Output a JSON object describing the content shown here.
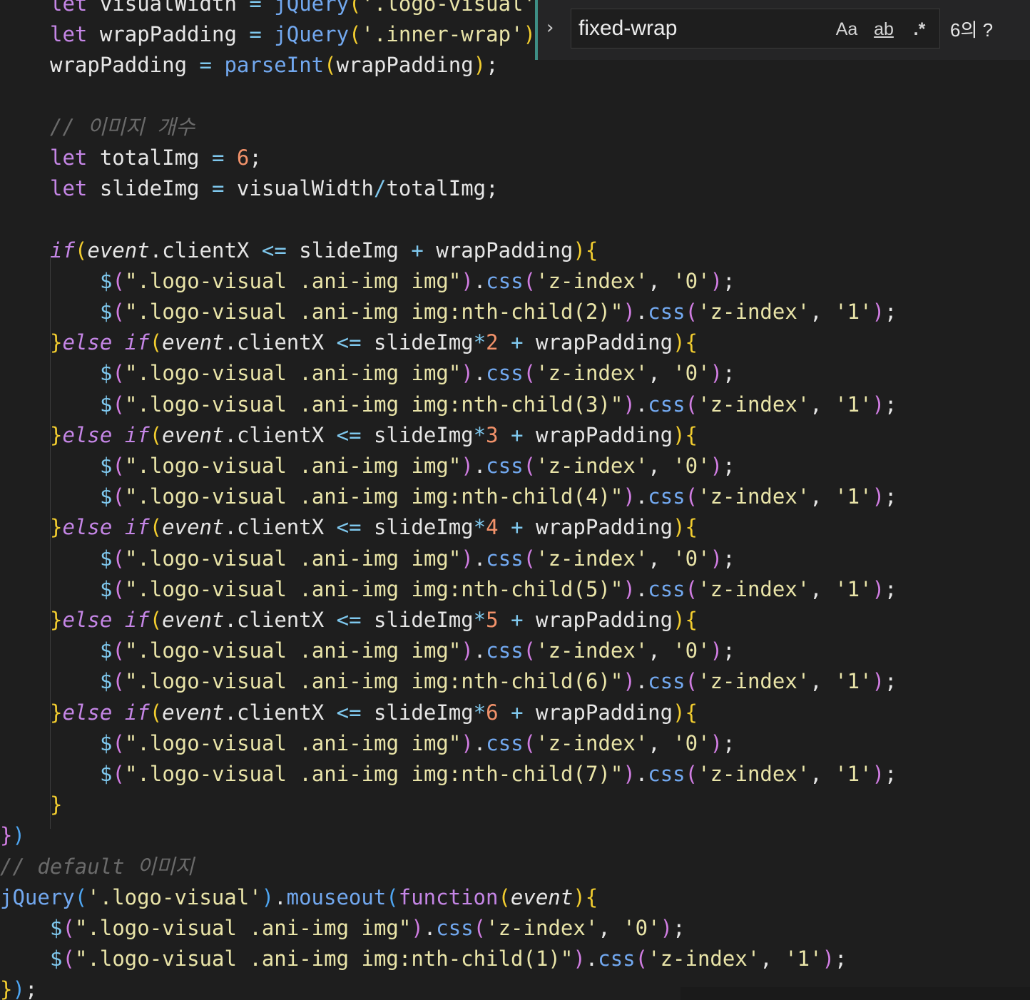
{
  "find_widget": {
    "query": "fixed-wrap",
    "match_case_label": "Aa",
    "whole_word_label": "ab",
    "regex_label": ".*",
    "result_count": "6의 ?",
    "expand_icon": "chevron-right-icon"
  },
  "code": [
    {
      "indent": 1,
      "tokens": [
        [
          "k",
          "let "
        ],
        [
          "v",
          "visualWidth "
        ],
        [
          "o",
          "= "
        ],
        [
          "f",
          "jQuery"
        ],
        [
          "b1",
          "("
        ],
        [
          "s",
          "'.logo-visual'"
        ]
      ]
    },
    {
      "indent": 1,
      "tokens": [
        [
          "k",
          "let "
        ],
        [
          "v",
          "wrapPadding "
        ],
        [
          "o",
          "= "
        ],
        [
          "f",
          "jQuery"
        ],
        [
          "b1",
          "("
        ],
        [
          "s",
          "'.inner-wrap'"
        ],
        [
          "b1",
          ")"
        ]
      ]
    },
    {
      "indent": 1,
      "tokens": [
        [
          "v",
          "wrapPadding "
        ],
        [
          "o",
          "= "
        ],
        [
          "f",
          "parseInt"
        ],
        [
          "b1",
          "("
        ],
        [
          "v",
          "wrapPadding"
        ],
        [
          "b1",
          ")"
        ],
        [
          "p",
          ";"
        ]
      ]
    },
    {
      "indent": 0,
      "tokens": []
    },
    {
      "indent": 1,
      "tokens": [
        [
          "c",
          "// 이미지 개수"
        ]
      ]
    },
    {
      "indent": 1,
      "tokens": [
        [
          "k",
          "let "
        ],
        [
          "v",
          "totalImg "
        ],
        [
          "o",
          "= "
        ],
        [
          "n",
          "6"
        ],
        [
          "p",
          ";"
        ]
      ]
    },
    {
      "indent": 1,
      "tokens": [
        [
          "k",
          "let "
        ],
        [
          "v",
          "slideImg "
        ],
        [
          "o",
          "= "
        ],
        [
          "v",
          "visualWidth"
        ],
        [
          "o",
          "/"
        ],
        [
          "v",
          "totalImg"
        ],
        [
          "p",
          ";"
        ]
      ]
    },
    {
      "indent": 0,
      "tokens": []
    },
    {
      "indent": 1,
      "tokens": [
        [
          "ki",
          "if"
        ],
        [
          "b1",
          "("
        ],
        [
          "it",
          "event"
        ],
        [
          "p",
          "."
        ],
        [
          "v",
          "clientX "
        ],
        [
          "o",
          "<= "
        ],
        [
          "v",
          "slideImg "
        ],
        [
          "o",
          "+ "
        ],
        [
          "v",
          "wrapPadding"
        ],
        [
          "b1",
          ")"
        ],
        [
          "b1",
          "{"
        ]
      ]
    },
    {
      "indent": 2,
      "tokens": [
        [
          "o",
          "$"
        ],
        [
          "b2",
          "("
        ],
        [
          "s",
          "\".logo-visual .ani-img img\""
        ],
        [
          "b2",
          ")"
        ],
        [
          "p",
          "."
        ],
        [
          "f",
          "css"
        ],
        [
          "b2",
          "("
        ],
        [
          "s",
          "'z-index'"
        ],
        [
          "p",
          ", "
        ],
        [
          "s",
          "'0'"
        ],
        [
          "b2",
          ")"
        ],
        [
          "p",
          ";"
        ]
      ]
    },
    {
      "indent": 2,
      "tokens": [
        [
          "o",
          "$"
        ],
        [
          "b2",
          "("
        ],
        [
          "s",
          "\".logo-visual .ani-img img:nth-child(2)\""
        ],
        [
          "b2",
          ")"
        ],
        [
          "p",
          "."
        ],
        [
          "f",
          "css"
        ],
        [
          "b2",
          "("
        ],
        [
          "s",
          "'z-index'"
        ],
        [
          "p",
          ", "
        ],
        [
          "s",
          "'1'"
        ],
        [
          "b2",
          ")"
        ],
        [
          "p",
          ";"
        ]
      ]
    },
    {
      "indent": 1,
      "tokens": [
        [
          "b1",
          "}"
        ],
        [
          "ki",
          "else if"
        ],
        [
          "b1",
          "("
        ],
        [
          "it",
          "event"
        ],
        [
          "p",
          "."
        ],
        [
          "v",
          "clientX "
        ],
        [
          "o",
          "<= "
        ],
        [
          "v",
          "slideImg"
        ],
        [
          "o",
          "*"
        ],
        [
          "n",
          "2 "
        ],
        [
          "o",
          "+ "
        ],
        [
          "v",
          "wrapPadding"
        ],
        [
          "b1",
          ")"
        ],
        [
          "b1",
          "{"
        ]
      ]
    },
    {
      "indent": 2,
      "tokens": [
        [
          "o",
          "$"
        ],
        [
          "b2",
          "("
        ],
        [
          "s",
          "\".logo-visual .ani-img img\""
        ],
        [
          "b2",
          ")"
        ],
        [
          "p",
          "."
        ],
        [
          "f",
          "css"
        ],
        [
          "b2",
          "("
        ],
        [
          "s",
          "'z-index'"
        ],
        [
          "p",
          ", "
        ],
        [
          "s",
          "'0'"
        ],
        [
          "b2",
          ")"
        ],
        [
          "p",
          ";"
        ]
      ]
    },
    {
      "indent": 2,
      "tokens": [
        [
          "o",
          "$"
        ],
        [
          "b2",
          "("
        ],
        [
          "s",
          "\".logo-visual .ani-img img:nth-child(3)\""
        ],
        [
          "b2",
          ")"
        ],
        [
          "p",
          "."
        ],
        [
          "f",
          "css"
        ],
        [
          "b2",
          "("
        ],
        [
          "s",
          "'z-index'"
        ],
        [
          "p",
          ", "
        ],
        [
          "s",
          "'1'"
        ],
        [
          "b2",
          ")"
        ],
        [
          "p",
          ";"
        ]
      ]
    },
    {
      "indent": 1,
      "tokens": [
        [
          "b1",
          "}"
        ],
        [
          "ki",
          "else if"
        ],
        [
          "b1",
          "("
        ],
        [
          "it",
          "event"
        ],
        [
          "p",
          "."
        ],
        [
          "v",
          "clientX "
        ],
        [
          "o",
          "<= "
        ],
        [
          "v",
          "slideImg"
        ],
        [
          "o",
          "*"
        ],
        [
          "n",
          "3 "
        ],
        [
          "o",
          "+ "
        ],
        [
          "v",
          "wrapPadding"
        ],
        [
          "b1",
          ")"
        ],
        [
          "b1",
          "{"
        ]
      ]
    },
    {
      "indent": 2,
      "tokens": [
        [
          "o",
          "$"
        ],
        [
          "b2",
          "("
        ],
        [
          "s",
          "\".logo-visual .ani-img img\""
        ],
        [
          "b2",
          ")"
        ],
        [
          "p",
          "."
        ],
        [
          "f",
          "css"
        ],
        [
          "b2",
          "("
        ],
        [
          "s",
          "'z-index'"
        ],
        [
          "p",
          ", "
        ],
        [
          "s",
          "'0'"
        ],
        [
          "b2",
          ")"
        ],
        [
          "p",
          ";"
        ]
      ]
    },
    {
      "indent": 2,
      "tokens": [
        [
          "o",
          "$"
        ],
        [
          "b2",
          "("
        ],
        [
          "s",
          "\".logo-visual .ani-img img:nth-child(4)\""
        ],
        [
          "b2",
          ")"
        ],
        [
          "p",
          "."
        ],
        [
          "f",
          "css"
        ],
        [
          "b2",
          "("
        ],
        [
          "s",
          "'z-index'"
        ],
        [
          "p",
          ", "
        ],
        [
          "s",
          "'1'"
        ],
        [
          "b2",
          ")"
        ],
        [
          "p",
          ";"
        ]
      ]
    },
    {
      "indent": 1,
      "tokens": [
        [
          "b1",
          "}"
        ],
        [
          "ki",
          "else if"
        ],
        [
          "b1",
          "("
        ],
        [
          "it",
          "event"
        ],
        [
          "p",
          "."
        ],
        [
          "v",
          "clientX "
        ],
        [
          "o",
          "<= "
        ],
        [
          "v",
          "slideImg"
        ],
        [
          "o",
          "*"
        ],
        [
          "n",
          "4 "
        ],
        [
          "o",
          "+ "
        ],
        [
          "v",
          "wrapPadding"
        ],
        [
          "b1",
          ")"
        ],
        [
          "b1",
          "{"
        ]
      ]
    },
    {
      "indent": 2,
      "tokens": [
        [
          "o",
          "$"
        ],
        [
          "b2",
          "("
        ],
        [
          "s",
          "\".logo-visual .ani-img img\""
        ],
        [
          "b2",
          ")"
        ],
        [
          "p",
          "."
        ],
        [
          "f",
          "css"
        ],
        [
          "b2",
          "("
        ],
        [
          "s",
          "'z-index'"
        ],
        [
          "p",
          ", "
        ],
        [
          "s",
          "'0'"
        ],
        [
          "b2",
          ")"
        ],
        [
          "p",
          ";"
        ]
      ]
    },
    {
      "indent": 2,
      "tokens": [
        [
          "o",
          "$"
        ],
        [
          "b2",
          "("
        ],
        [
          "s",
          "\".logo-visual .ani-img img:nth-child(5)\""
        ],
        [
          "b2",
          ")"
        ],
        [
          "p",
          "."
        ],
        [
          "f",
          "css"
        ],
        [
          "b2",
          "("
        ],
        [
          "s",
          "'z-index'"
        ],
        [
          "p",
          ", "
        ],
        [
          "s",
          "'1'"
        ],
        [
          "b2",
          ")"
        ],
        [
          "p",
          ";"
        ]
      ]
    },
    {
      "indent": 1,
      "tokens": [
        [
          "b1",
          "}"
        ],
        [
          "ki",
          "else if"
        ],
        [
          "b1",
          "("
        ],
        [
          "it",
          "event"
        ],
        [
          "p",
          "."
        ],
        [
          "v",
          "clientX "
        ],
        [
          "o",
          "<= "
        ],
        [
          "v",
          "slideImg"
        ],
        [
          "o",
          "*"
        ],
        [
          "n",
          "5 "
        ],
        [
          "o",
          "+ "
        ],
        [
          "v",
          "wrapPadding"
        ],
        [
          "b1",
          ")"
        ],
        [
          "b1",
          "{"
        ]
      ]
    },
    {
      "indent": 2,
      "tokens": [
        [
          "o",
          "$"
        ],
        [
          "b2",
          "("
        ],
        [
          "s",
          "\".logo-visual .ani-img img\""
        ],
        [
          "b2",
          ")"
        ],
        [
          "p",
          "."
        ],
        [
          "f",
          "css"
        ],
        [
          "b2",
          "("
        ],
        [
          "s",
          "'z-index'"
        ],
        [
          "p",
          ", "
        ],
        [
          "s",
          "'0'"
        ],
        [
          "b2",
          ")"
        ],
        [
          "p",
          ";"
        ]
      ]
    },
    {
      "indent": 2,
      "tokens": [
        [
          "o",
          "$"
        ],
        [
          "b2",
          "("
        ],
        [
          "s",
          "\".logo-visual .ani-img img:nth-child(6)\""
        ],
        [
          "b2",
          ")"
        ],
        [
          "p",
          "."
        ],
        [
          "f",
          "css"
        ],
        [
          "b2",
          "("
        ],
        [
          "s",
          "'z-index'"
        ],
        [
          "p",
          ", "
        ],
        [
          "s",
          "'1'"
        ],
        [
          "b2",
          ")"
        ],
        [
          "p",
          ";"
        ]
      ]
    },
    {
      "indent": 1,
      "tokens": [
        [
          "b1",
          "}"
        ],
        [
          "ki",
          "else if"
        ],
        [
          "b1",
          "("
        ],
        [
          "it",
          "event"
        ],
        [
          "p",
          "."
        ],
        [
          "v",
          "clientX "
        ],
        [
          "o",
          "<= "
        ],
        [
          "v",
          "slideImg"
        ],
        [
          "o",
          "*"
        ],
        [
          "n",
          "6 "
        ],
        [
          "o",
          "+ "
        ],
        [
          "v",
          "wrapPadding"
        ],
        [
          "b1",
          ")"
        ],
        [
          "b1",
          "{"
        ]
      ]
    },
    {
      "indent": 2,
      "tokens": [
        [
          "o",
          "$"
        ],
        [
          "b2",
          "("
        ],
        [
          "s",
          "\".logo-visual .ani-img img\""
        ],
        [
          "b2",
          ")"
        ],
        [
          "p",
          "."
        ],
        [
          "f",
          "css"
        ],
        [
          "b2",
          "("
        ],
        [
          "s",
          "'z-index'"
        ],
        [
          "p",
          ", "
        ],
        [
          "s",
          "'0'"
        ],
        [
          "b2",
          ")"
        ],
        [
          "p",
          ";"
        ]
      ]
    },
    {
      "indent": 2,
      "tokens": [
        [
          "o",
          "$"
        ],
        [
          "b2",
          "("
        ],
        [
          "s",
          "\".logo-visual .ani-img img:nth-child(7)\""
        ],
        [
          "b2",
          ")"
        ],
        [
          "p",
          "."
        ],
        [
          "f",
          "css"
        ],
        [
          "b2",
          "("
        ],
        [
          "s",
          "'z-index'"
        ],
        [
          "p",
          ", "
        ],
        [
          "s",
          "'1'"
        ],
        [
          "b2",
          ")"
        ],
        [
          "p",
          ";"
        ]
      ]
    },
    {
      "indent": 1,
      "tokens": [
        [
          "b1",
          "}"
        ]
      ]
    },
    {
      "indent": 0,
      "tokens": [
        [
          "b2",
          "}"
        ],
        [
          "b3",
          ")"
        ]
      ]
    },
    {
      "indent": 0,
      "tokens": [
        [
          "c",
          "// default 이미지"
        ]
      ]
    },
    {
      "indent": 0,
      "tokens": [
        [
          "f",
          "jQuery"
        ],
        [
          "b3",
          "("
        ],
        [
          "s",
          "'.logo-visual'"
        ],
        [
          "b3",
          ")"
        ],
        [
          "p",
          "."
        ],
        [
          "f",
          "mouseout"
        ],
        [
          "b3",
          "("
        ],
        [
          "k",
          "function"
        ],
        [
          "b1",
          "("
        ],
        [
          "it",
          "event"
        ],
        [
          "b1",
          ")"
        ],
        [
          "b1",
          "{"
        ]
      ]
    },
    {
      "indent": 1,
      "tokens": [
        [
          "o",
          "$"
        ],
        [
          "b2",
          "("
        ],
        [
          "s",
          "\".logo-visual .ani-img img\""
        ],
        [
          "b2",
          ")"
        ],
        [
          "p",
          "."
        ],
        [
          "f",
          "css"
        ],
        [
          "b2",
          "("
        ],
        [
          "s",
          "'z-index'"
        ],
        [
          "p",
          ", "
        ],
        [
          "s",
          "'0'"
        ],
        [
          "b2",
          ")"
        ],
        [
          "p",
          ";"
        ]
      ]
    },
    {
      "indent": 1,
      "tokens": [
        [
          "o",
          "$"
        ],
        [
          "b2",
          "("
        ],
        [
          "s",
          "\".logo-visual .ani-img img:nth-child(1)\""
        ],
        [
          "b2",
          ")"
        ],
        [
          "p",
          "."
        ],
        [
          "f",
          "css"
        ],
        [
          "b2",
          "("
        ],
        [
          "s",
          "'z-index'"
        ],
        [
          "p",
          ", "
        ],
        [
          "s",
          "'1'"
        ],
        [
          "b2",
          ")"
        ],
        [
          "p",
          ";"
        ]
      ]
    },
    {
      "indent": 0,
      "tokens": [
        [
          "b1",
          "}"
        ],
        [
          "b3",
          ")"
        ],
        [
          "p",
          ";"
        ]
      ]
    }
  ]
}
